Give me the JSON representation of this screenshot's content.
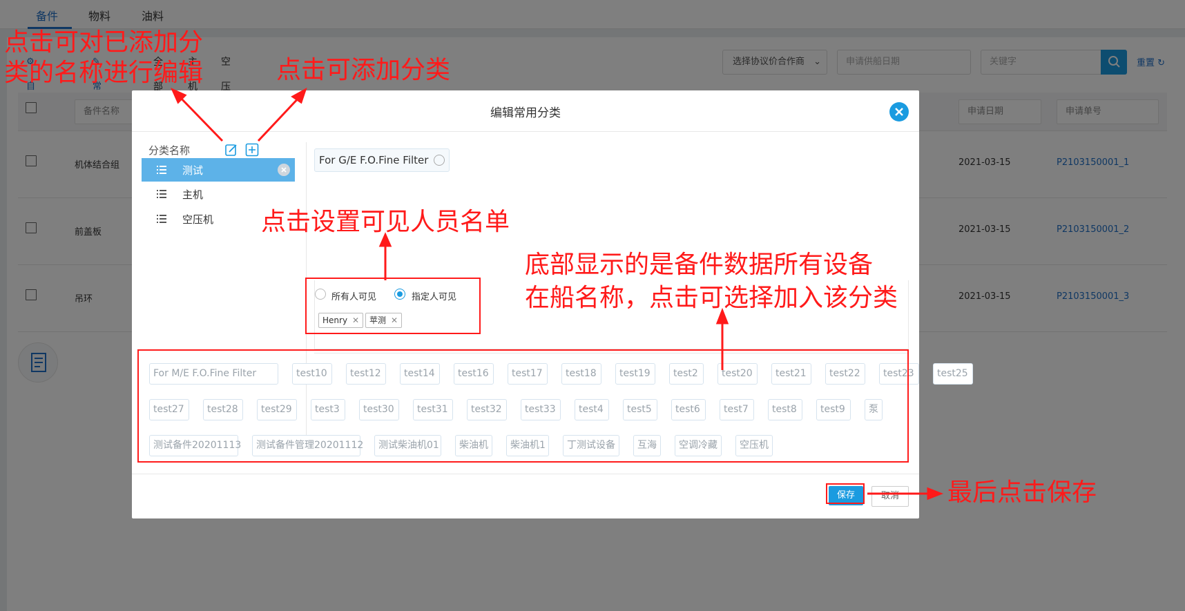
{
  "page": {
    "tabs": [
      "备件",
      "物料",
      "油料"
    ],
    "toolbar": {
      "auto_inquiry": "自动询价",
      "common_category": "常用分类",
      "filter_all": "全部",
      "filter_main": "主机",
      "filter_compressor": "空压机"
    },
    "filters": {
      "partner_select": "选择协议价合作商",
      "ship_date_placeholder": "申请供船日期",
      "keyword_placeholder": "关键字",
      "reset": "重置"
    },
    "table": {
      "headers": [
        "备件名称",
        "申请日期",
        "申请单号"
      ],
      "rows": [
        {
          "name": "机体结合组",
          "date": "2021-03-15",
          "number": "P2103150001_1"
        },
        {
          "name": "前盖板",
          "date": "2021-03-15",
          "number": "P2103150001_2"
        },
        {
          "name": "吊环",
          "date": "2021-03-15",
          "number": "P2103150001_3"
        }
      ]
    }
  },
  "modal": {
    "title": "编辑常用分类",
    "category_header": "分类名称",
    "categories": [
      {
        "label": "测试",
        "active": true
      },
      {
        "label": "主机",
        "active": false
      },
      {
        "label": "空压机",
        "active": false
      }
    ],
    "selected_items": [
      "For G/E F.O.Fine Filter"
    ],
    "visibility": {
      "options": [
        "所有人可见",
        "指定人可见"
      ],
      "selected": "指定人可见",
      "people": [
        "Henry",
        "苹测"
      ]
    },
    "equipment": [
      "For M/E F.O.Fine Filter",
      "test10",
      "test12",
      "test14",
      "test16",
      "test17",
      "test18",
      "test19",
      "test2",
      "test20",
      "test21",
      "test22",
      "test23",
      "test25",
      "test27",
      "test28",
      "test29",
      "test3",
      "test30",
      "test31",
      "test32",
      "test33",
      "test4",
      "test5",
      "test6",
      "test7",
      "test8",
      "test9",
      "泵",
      "测试备件20201113",
      "测试备件管理20201112",
      "测试柴油机01",
      "柴油机",
      "柴油机1",
      "丁测试设备",
      "互海",
      "空调冷藏",
      "空压机"
    ],
    "save": "保存",
    "cancel": "取消"
  },
  "annotations": {
    "edit_note_line1": "点击可对已添加分",
    "edit_note_line2": "类的名称进行编辑",
    "add_note": "点击可添加分类",
    "visible_note": "点击设置可见人员名单",
    "equip_note_line1": "底部显示的是备件数据所有设备",
    "equip_note_line2": "在船名称，点击可选择加入该分类",
    "save_note": "最后点击保存",
    "color": "#ff1a1a"
  },
  "colors": {
    "accent": "#1a9be0",
    "active_category": "#5db2e8",
    "link": "#1f6fc7"
  }
}
